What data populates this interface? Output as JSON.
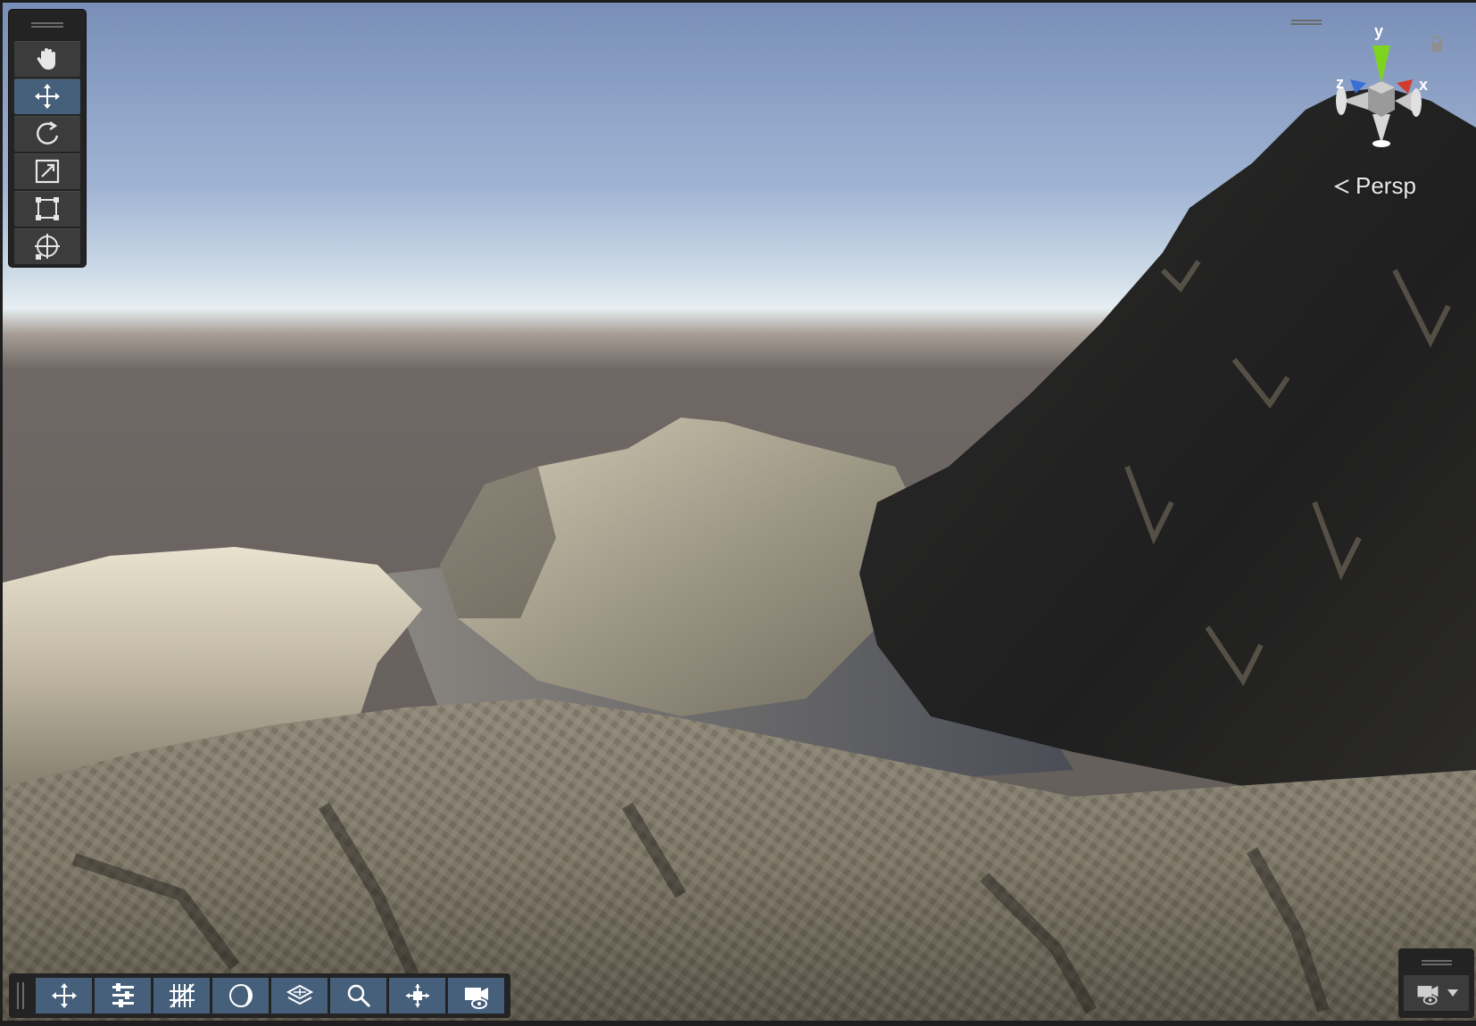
{
  "viewport": {
    "projection_label": "Persp",
    "axes": {
      "x": "x",
      "y": "y",
      "z": "z"
    }
  },
  "tools": [
    {
      "id": "hand",
      "icon": "hand-icon",
      "active": false
    },
    {
      "id": "move",
      "icon": "move-icon",
      "active": true
    },
    {
      "id": "rotate",
      "icon": "rotate-icon",
      "active": false
    },
    {
      "id": "scale",
      "icon": "scale-icon",
      "active": false
    },
    {
      "id": "rect",
      "icon": "rect-transform-icon",
      "active": false
    },
    {
      "id": "transform",
      "icon": "transform-icon",
      "active": false
    }
  ],
  "overlay_toolbar": [
    {
      "icon": "move-tool-icon"
    },
    {
      "icon": "settings-sliders-icon"
    },
    {
      "icon": "grid-icon"
    },
    {
      "icon": "shading-icon"
    },
    {
      "icon": "layers-icon"
    },
    {
      "icon": "search-icon"
    },
    {
      "icon": "component-tools-icon"
    },
    {
      "icon": "camera-visibility-icon"
    }
  ],
  "colors": {
    "active_button": "#46607c",
    "panel": "#232323",
    "axis_x": "#d23c2c",
    "axis_y": "#7ed321",
    "axis_z": "#3a6fd8"
  }
}
